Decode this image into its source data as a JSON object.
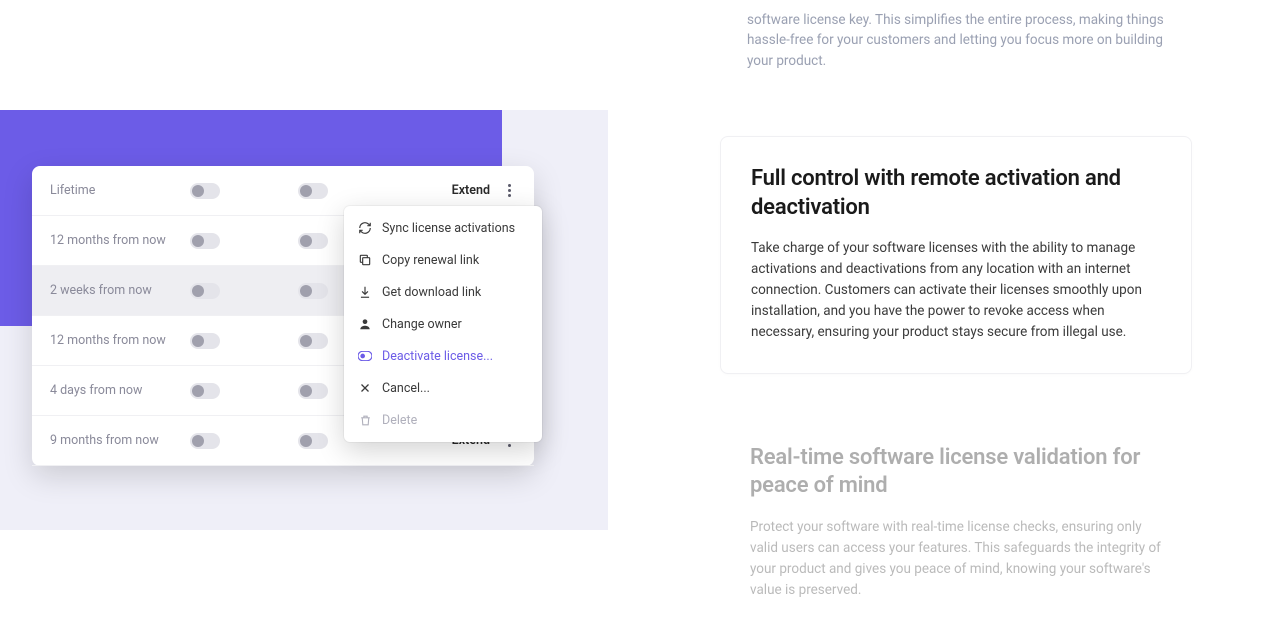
{
  "top_fragment": "software license key. This simplifies the entire process, making things hassle-free for your customers and letting you focus more on building your product.",
  "license_rows": [
    {
      "label": "Lifetime",
      "extend": "Extend",
      "show_extend": true
    },
    {
      "label": "12 months from now",
      "extend": "",
      "show_extend": false
    },
    {
      "label": "2 weeks from now",
      "extend": "",
      "show_extend": false,
      "selected": true
    },
    {
      "label": "12 months from now",
      "extend": "",
      "show_extend": false
    },
    {
      "label": "4 days from now",
      "extend": "",
      "show_extend": false
    },
    {
      "label": "9 months from now",
      "extend": "Extend",
      "show_extend": true
    }
  ],
  "dropdown": {
    "sync": "Sync license activations",
    "copy": "Copy renewal link",
    "download": "Get download link",
    "owner": "Change owner",
    "deactivate": "Deactivate license...",
    "cancel": "Cancel...",
    "delete": "Delete"
  },
  "feature": {
    "title": "Full control with remote activation and deactivation",
    "body": "Take charge of your software licenses with the ability to manage activations and deactivations from any location with an internet connection. Customers can activate their licenses smoothly upon installation, and you have the power to revoke access when necessary, ensuring your product stays secure from illegal use."
  },
  "faded": {
    "title": "Real-time software license validation for peace of mind",
    "body": "Protect your software with real-time license checks, ensuring only valid users can access your features. This safeguards the integrity of your product and gives you peace of mind, knowing your software's value is preserved."
  }
}
